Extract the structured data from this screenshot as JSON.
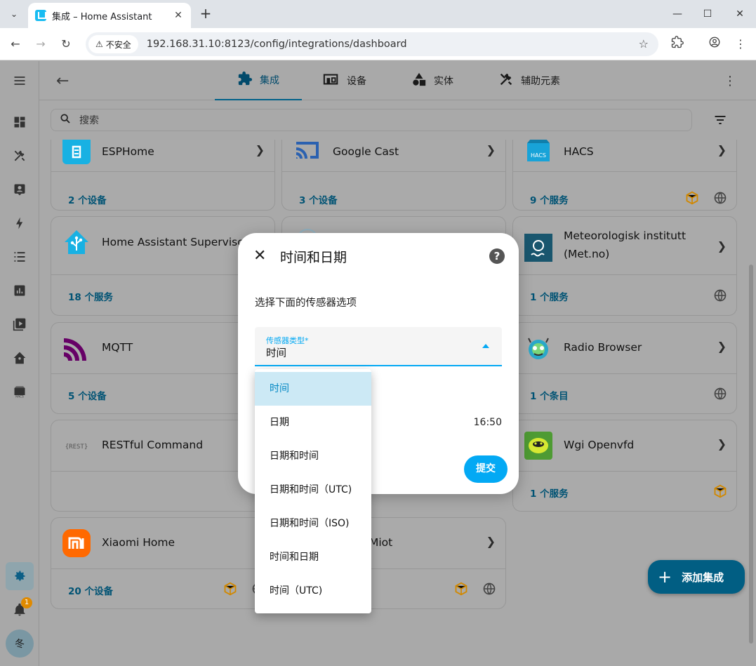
{
  "browser": {
    "tab_title": "集成 – Home Assistant",
    "security_chip": "不安全",
    "url": "192.168.31.10:8123/config/integrations/dashboard"
  },
  "header": {
    "tabs": [
      {
        "label": "集成",
        "icon": "puzzle-icon"
      },
      {
        "label": "设备",
        "icon": "devices-icon"
      },
      {
        "label": "实体",
        "icon": "shapes-icon"
      },
      {
        "label": "辅助元素",
        "icon": "tools-icon"
      }
    ]
  },
  "search": {
    "placeholder": "搜索"
  },
  "sidebar": {
    "notification_count": "1",
    "avatar_letter": "冬"
  },
  "cards": [
    {
      "name": "ESPHome",
      "link": "2 个设备"
    },
    {
      "name": "Google Cast",
      "link": "3 个设备"
    },
    {
      "name": "HACS",
      "link": "9 个服务"
    },
    {
      "name": "Home Assistant Supervisor",
      "link": "18 个服务"
    },
    {
      "name": "Meteorologisk institutt (Met.no)",
      "link": "1 个服务"
    },
    {
      "name": "MQTT",
      "link": "5 个设备"
    },
    {
      "name": "Radio Browser",
      "link": "1 个条目"
    },
    {
      "name": "RESTful Command",
      "link": ""
    },
    {
      "name": "Wgi Openvfd",
      "link": "1 个服务"
    },
    {
      "name": "Xiaomi Home",
      "link": "20 个设备"
    },
    {
      "name": "Miot",
      "link": ""
    }
  ],
  "fab": {
    "label": "添加集成"
  },
  "dialog": {
    "title": "时间和日期",
    "description": "选择下面的传感器选项",
    "select_label": "传感器类型*",
    "select_value": "时间",
    "time_preview": "16:50",
    "submit_label": "提交",
    "options": [
      "时间",
      "日期",
      "日期和时间",
      "日期和时间（UTC)",
      "日期和时间（ISO)",
      "时间和日期",
      "时间（UTC)"
    ]
  },
  "colors": {
    "accent": "#03a9f4",
    "primary": "#015e83",
    "badge": "#e08a00"
  }
}
